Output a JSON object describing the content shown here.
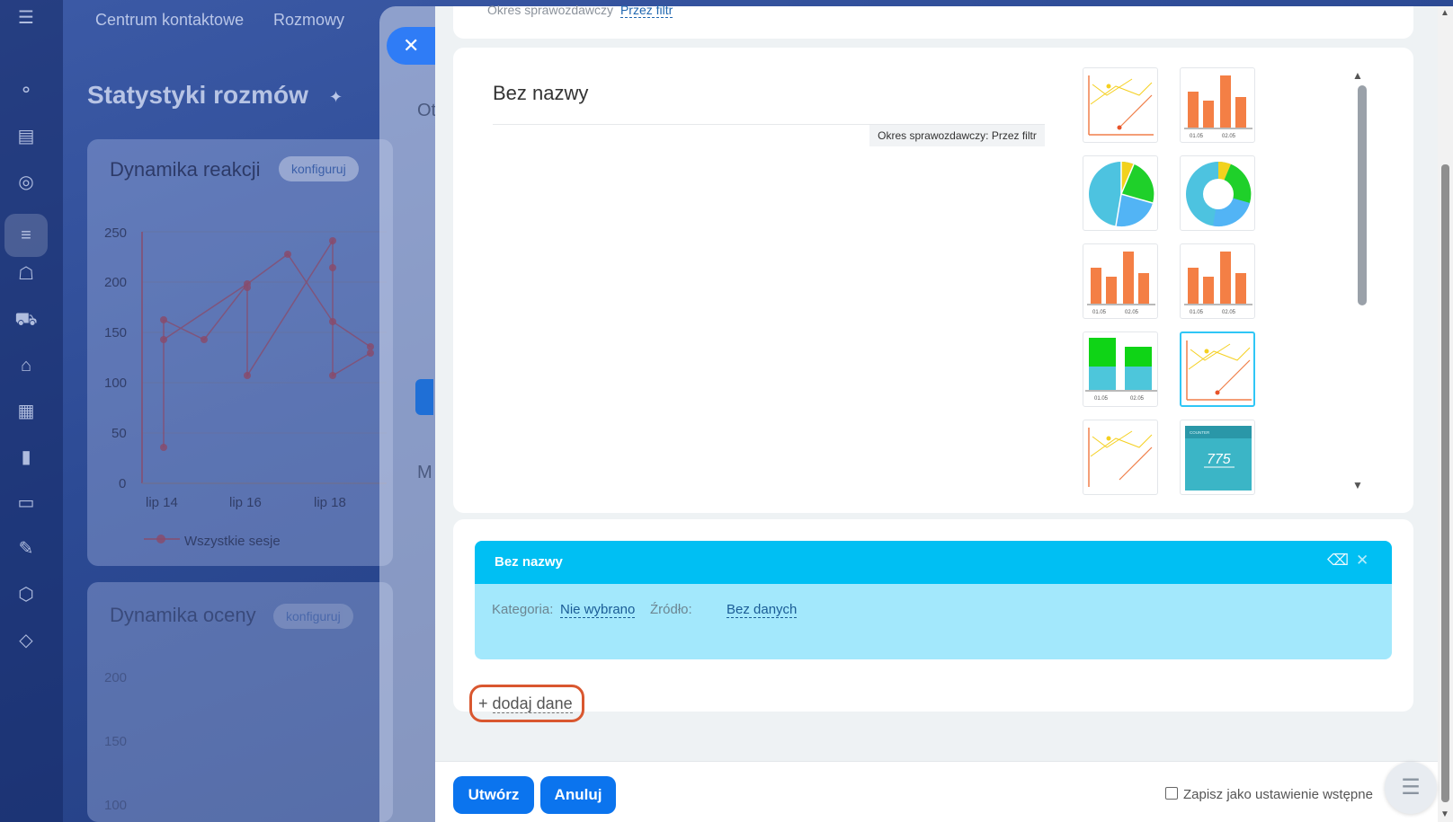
{
  "background": {
    "nav": [
      "Centrum kontaktowe",
      "Rozmowy"
    ],
    "page_title": "Statystyki rozmów",
    "card1": {
      "title": "Dynamika reakcji",
      "config": "konfiguruj",
      "y_ticks": [
        "250",
        "200",
        "150",
        "100",
        "50",
        "0"
      ],
      "x_ticks": [
        "lip 14",
        "lip 16",
        "lip 18"
      ],
      "legend": "Wszystkie sesje"
    },
    "card2": {
      "title": "Dynamika oceny",
      "config": "konfiguruj",
      "y_ticks": [
        "200",
        "150",
        "100"
      ]
    },
    "mid_fragments": [
      "Ot",
      "M"
    ]
  },
  "modal": {
    "period_top_label": "Okres sprawozdawczy",
    "period_top_link": "Przez filtr",
    "widget_title": "Bez nazwy",
    "period_badge": "Okres sprawozdawczy: Przez filtr",
    "thumb_labels": [
      "01.05",
      "02.05"
    ],
    "counter_caption": "COUNTER",
    "counter_value": "775",
    "dataset": {
      "title": "Bez nazwy",
      "category_label": "Kategoria:",
      "category_value": "Nie wybrano",
      "source_label": "Źródło:",
      "source_value": "Bez danych"
    },
    "add_data_plus": "+",
    "add_data": "dodaj dane",
    "create_button": "Utwórz",
    "cancel_button": "Anuluj",
    "save_default_label": "Zapisz jako ustawienie wstępne"
  },
  "colors": {
    "accent": "#0b74ee",
    "dataset_header": "#00bff3",
    "dataset_body": "#a3e8fc",
    "highlight_ring": "#d9572f"
  }
}
